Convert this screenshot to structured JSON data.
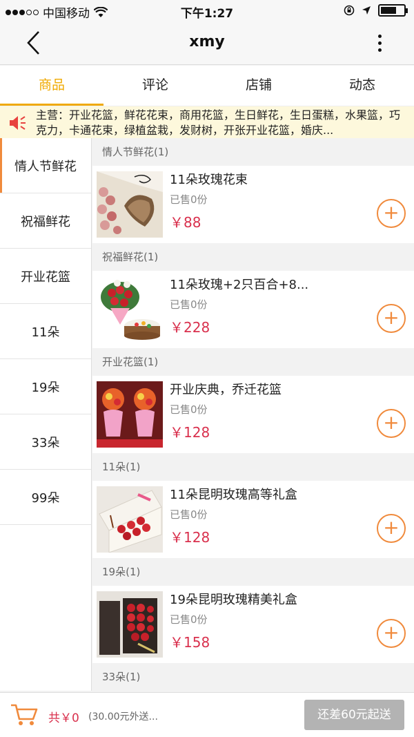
{
  "status_bar": {
    "carrier": "中国移动",
    "time": "下午1:27"
  },
  "nav": {
    "title": "xmy"
  },
  "tabs": [
    {
      "label": "商品",
      "active": true
    },
    {
      "label": "评论",
      "active": false
    },
    {
      "label": "店铺",
      "active": false
    },
    {
      "label": "动态",
      "active": false
    }
  ],
  "notice": {
    "text": "主营：开业花篮，鲜花花束，商用花篮，生日鲜花，生日蛋糕，水果篮，巧克力，卡通花束，绿植盆栽，发财树，开张开业花篮，婚庆..."
  },
  "sidebar": {
    "items": [
      {
        "label": "情人节鲜花",
        "active": true
      },
      {
        "label": "祝福鲜花",
        "active": false
      },
      {
        "label": "开业花篮",
        "active": false
      },
      {
        "label": "11朵",
        "active": false
      },
      {
        "label": "19朵",
        "active": false
      },
      {
        "label": "33朵",
        "active": false
      },
      {
        "label": "99朵",
        "active": false
      }
    ]
  },
  "sections": [
    {
      "header": "情人节鲜花(1)",
      "product": {
        "name": "11朵玫瑰花束",
        "sold": "已售0份",
        "price": "￥88",
        "image": "rose-bouquet-wrapped"
      }
    },
    {
      "header": "祝福鲜花(1)",
      "product": {
        "name": "11朵玫瑰+2只百合+8...",
        "sold": "已售0份",
        "price": "￥228",
        "image": "flowers-and-cake"
      }
    },
    {
      "header": "开业花篮(1)",
      "product": {
        "name": "开业庆典，乔迁花篮",
        "sold": "已售0份",
        "price": "￥128",
        "image": "opening-flower-baskets"
      }
    },
    {
      "header": "11朵(1)",
      "product": {
        "name": "11朵昆明玫瑰高等礼盒",
        "sold": "已售0份",
        "price": "￥128",
        "image": "roses-gift-box-white"
      }
    },
    {
      "header": "19朵(1)",
      "product": {
        "name": "19朵昆明玫瑰精美礼盒",
        "sold": "已售0份",
        "price": "￥158",
        "image": "roses-gift-box-dark"
      }
    },
    {
      "header": "33朵(1)"
    }
  ],
  "bottom_bar": {
    "total": "共￥0",
    "delivery_fee": "(30.00元外送...",
    "checkout_label": "还差60元起送"
  },
  "colors": {
    "accent": "#f0a900",
    "orange": "#f08a3c",
    "price": "#d9304d",
    "notice_bg": "#fdf8dc",
    "checkout_disabled": "#b3b3b3"
  }
}
